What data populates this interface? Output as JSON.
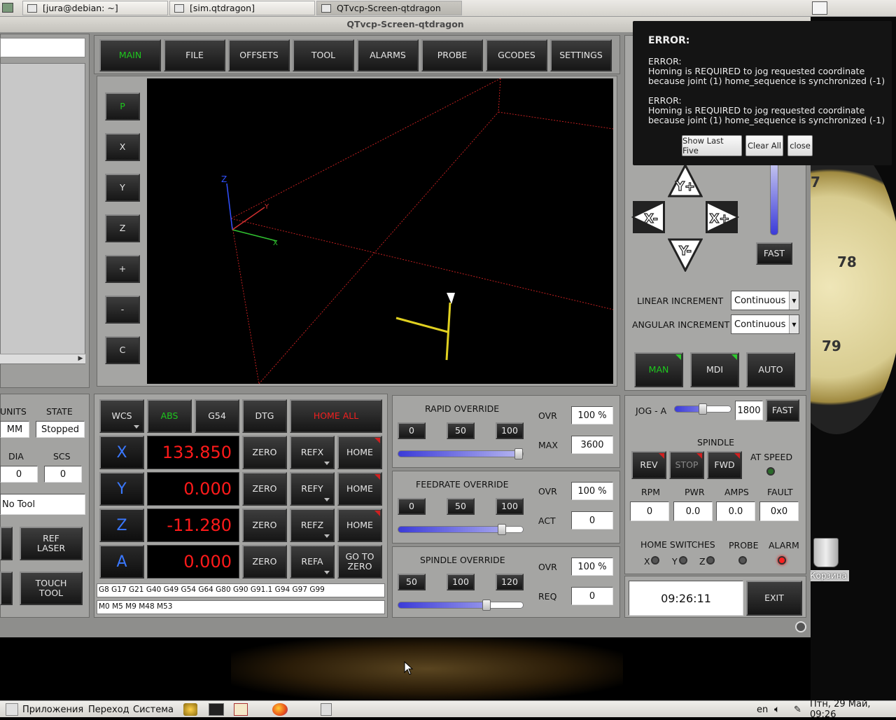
{
  "taskbar_top": {
    "tabs": [
      "[jura@debian: ~]",
      "[sim.qtdragon]",
      "QTvcp-Screen-qtdragon"
    ]
  },
  "window": {
    "title": "QTvcp-Screen-qtdragon"
  },
  "main_tabs": [
    "MAIN",
    "FILE",
    "OFFSETS",
    "TOOL",
    "ALARMS",
    "PROBE",
    "GCODES",
    "SETTINGS"
  ],
  "view_buttons": [
    "P",
    "X",
    "Y",
    "Z",
    "+",
    "-",
    "C"
  ],
  "status": {
    "units_label": "UNITS",
    "state_label": "STATE",
    "units": "MM",
    "state": "Stopped",
    "dia_label": "DIA",
    "scs_label": "SCS",
    "dia": "0",
    "scs": "0",
    "tool": "No Tool",
    "ref_laser": "REF\nLASER",
    "touch_tool": "TOUCH\nTOOL"
  },
  "dro": {
    "header": [
      "WCS",
      "ABS",
      "G54",
      "DTG",
      "HOME ALL"
    ],
    "axes": [
      {
        "name": "X",
        "value": "133.850",
        "zero": "ZERO",
        "ref": "REFX",
        "home": "HOME"
      },
      {
        "name": "Y",
        "value": "0.000",
        "zero": "ZERO",
        "ref": "REFY",
        "home": "HOME"
      },
      {
        "name": "Z",
        "value": "-11.280",
        "zero": "ZERO",
        "ref": "REFZ",
        "home": "HOME"
      },
      {
        "name": "A",
        "value": "0.000",
        "zero": "ZERO",
        "ref": "REFA",
        "home": "GO TO\nZERO"
      }
    ],
    "gcodes": "G8 G17 G21 G40 G49 G54 G64 G80 G90 G91.1 G94 G97 G99",
    "mcodes": "M0 M5 M9 M48 M53"
  },
  "rapid": {
    "title": "RAPID OVERRIDE",
    "btns": [
      "0",
      "50",
      "100"
    ],
    "ovr_label": "OVR",
    "ovr": "100 %",
    "max_label": "MAX",
    "max": "3600",
    "fill_pct": 100
  },
  "feed": {
    "title": "FEEDRATE OVERRIDE",
    "btns": [
      "0",
      "50",
      "100"
    ],
    "ovr_label": "OVR",
    "ovr": "100 %",
    "act_label": "ACT",
    "act": "0",
    "fill_pct": 83
  },
  "spindle_ovr": {
    "title": "SPINDLE OVERRIDE",
    "btns": [
      "50",
      "100",
      "120"
    ],
    "ovr_label": "OVR",
    "ovr": "100 %",
    "req_label": "REQ",
    "req": "0",
    "fill_pct": 71
  },
  "jog": {
    "ypos": "Y+",
    "yneg": "Y-",
    "xneg": "X-",
    "xpos": "X+",
    "fast": "FAST",
    "lin_label": "LINEAR INCREMENT",
    "lin": "Continuous",
    "ang_label": "ANGULAR INCREMENT",
    "ang": "Continuous"
  },
  "modes": [
    "MAN",
    "MDI",
    "AUTO"
  ],
  "jog_a": {
    "label": "JOG - A",
    "value": "1800",
    "fast": "FAST"
  },
  "spindle": {
    "title": "SPINDLE",
    "rev": "REV",
    "stop": "STOP",
    "fwd": "FWD",
    "at_speed": "AT SPEED",
    "rpm_label": "RPM",
    "pwr_label": "PWR",
    "amps_label": "AMPS",
    "fault_label": "FAULT",
    "rpm": "0",
    "pwr": "0.0",
    "amps": "0.0",
    "fault": "0x0"
  },
  "switches": {
    "home_label": "HOME SWITCHES",
    "probe_label": "PROBE",
    "alarm_label": "ALARM",
    "x": "X",
    "y": "Y",
    "z": "Z"
  },
  "clock": "09:26:11",
  "exit": "EXIT",
  "notification": {
    "title": "ERROR:",
    "msg1_head": "ERROR:",
    "msg1": "Homing is REQUIRED to jog requested coordinate\nbecause joint (1) home_sequence is synchronized (-1)",
    "msg2_head": "ERROR:",
    "msg2": "Homing is REQUIRED to jog requested coordinate\nbecause joint (1) home_sequence is synchronized (-1)",
    "show_last": "Show Last Five",
    "clear_all": "Clear All",
    "close": "close"
  },
  "desktop": {
    "trash": "Корзина",
    "dial_numbers": [
      "7",
      "78",
      "79"
    ]
  },
  "taskbar": {
    "apps": "Приложения",
    "places": "Переход",
    "system": "Система",
    "lang": "en",
    "datetime": "Птн, 29 Май, 09:26"
  },
  "preview": {
    "axis_labels": [
      "Z",
      "Y",
      "X"
    ]
  }
}
